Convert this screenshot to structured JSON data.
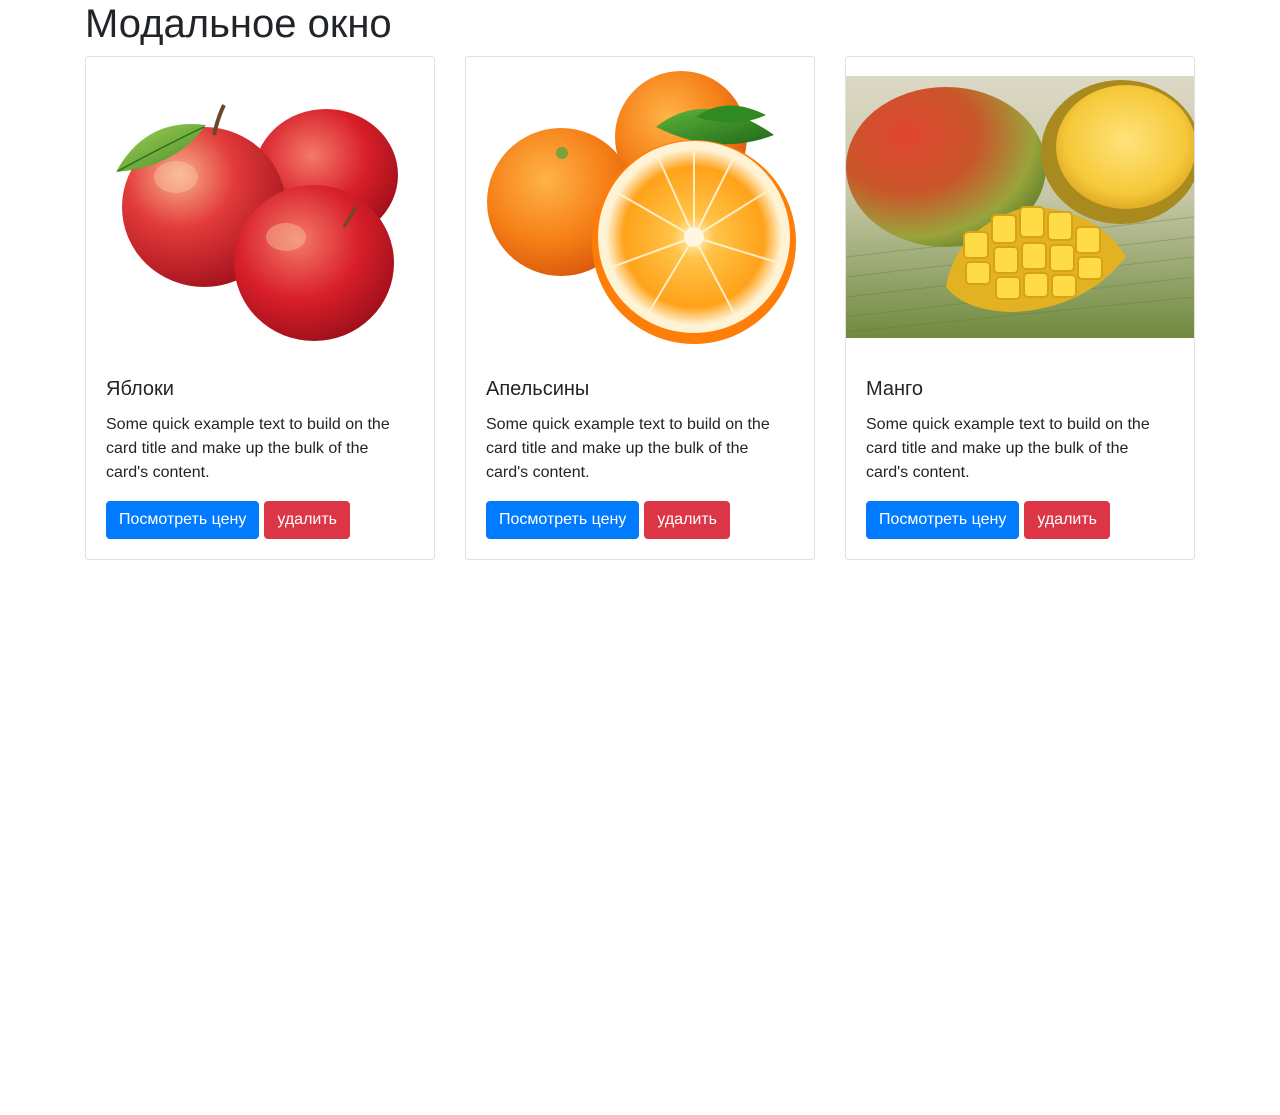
{
  "page": {
    "title": "Модальное окно"
  },
  "cards": [
    {
      "image": "apples-photo",
      "title": "Яблоки",
      "text": "Some quick example text to build on the card title and make up the bulk of the card's content.",
      "primary_label": "Посмотреть цену",
      "danger_label": "удалить"
    },
    {
      "image": "oranges-photo",
      "title": "Апельсины",
      "text": "Some quick example text to build on the card title and make up the bulk of the card's content.",
      "primary_label": "Посмотреть цену",
      "danger_label": "удалить"
    },
    {
      "image": "mango-photo",
      "title": "Манго",
      "text": "Some quick example text to build on the card title and make up the bulk of the card's content.",
      "primary_label": "Посмотреть цену",
      "danger_label": "удалить"
    }
  ],
  "colors": {
    "primary": "#007bff",
    "danger": "#dc3545",
    "text": "#212529",
    "card_border": "#dfdfdf"
  }
}
